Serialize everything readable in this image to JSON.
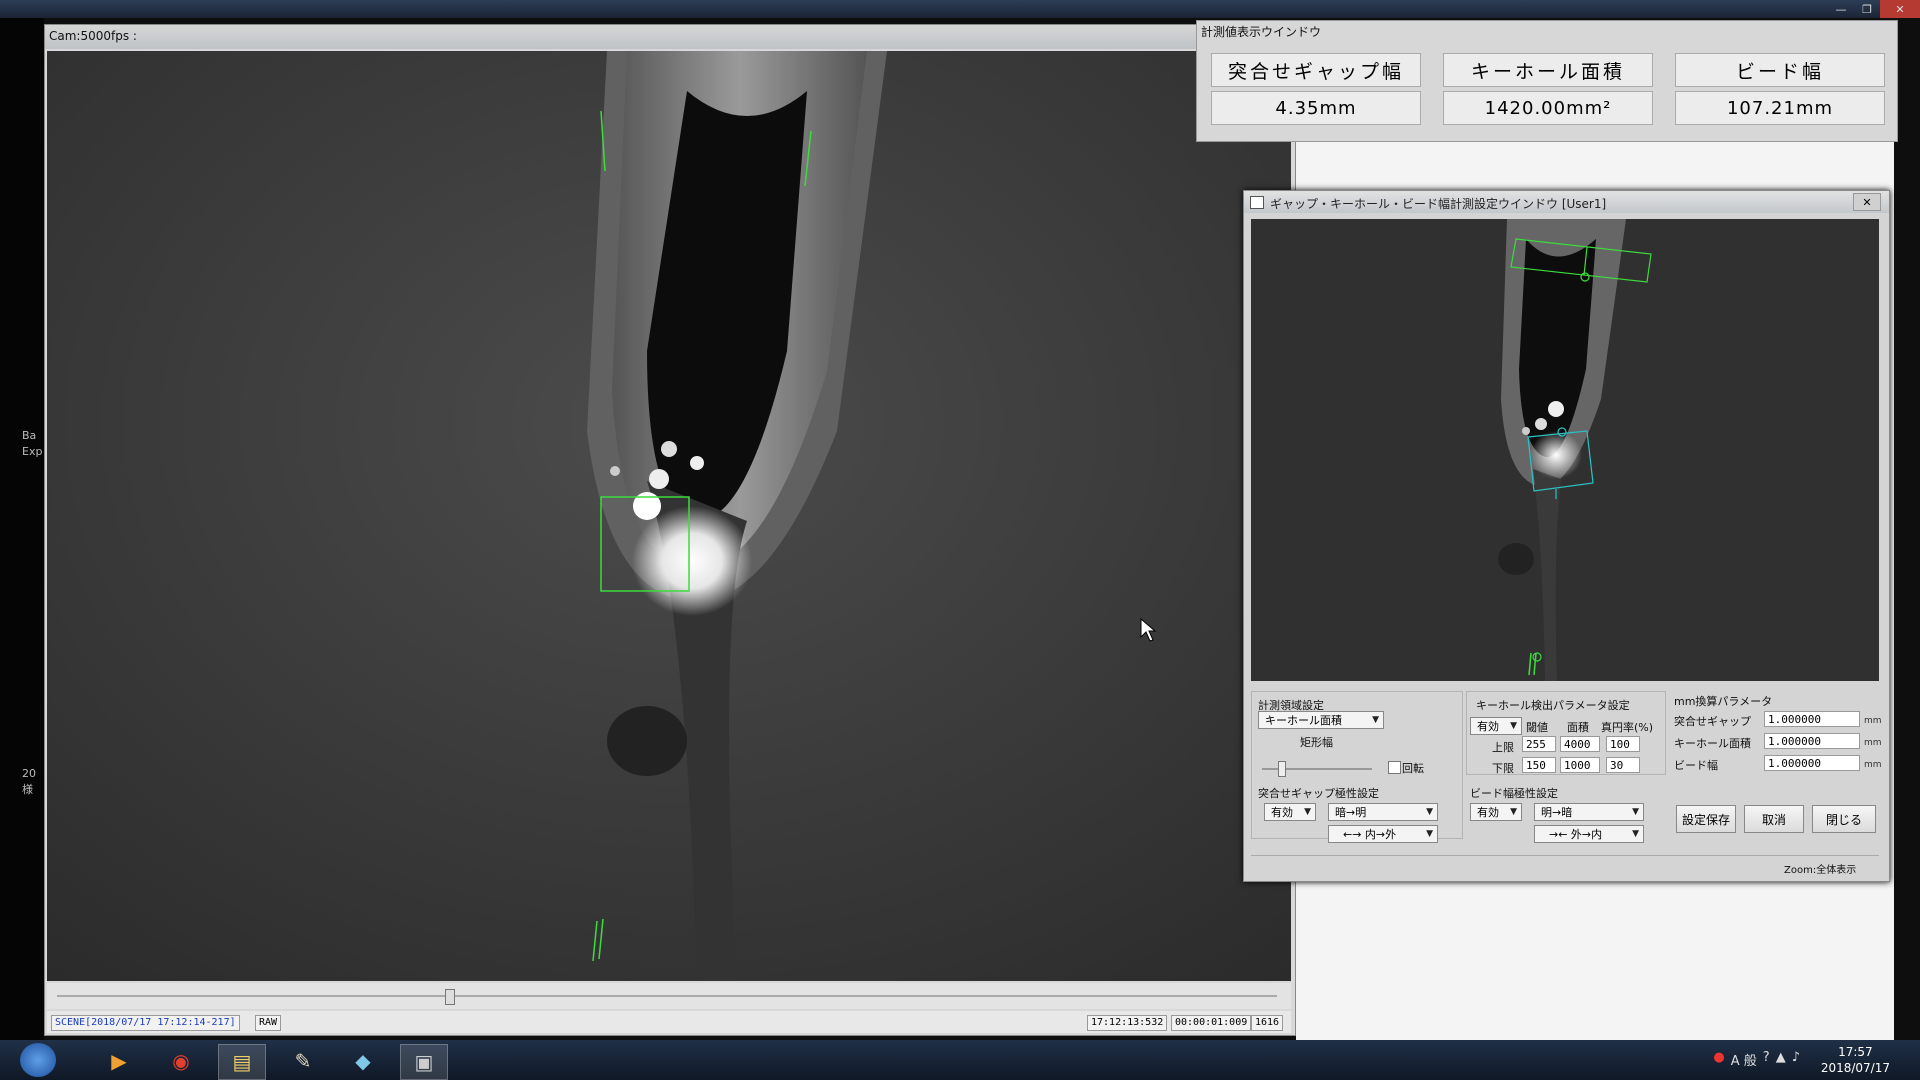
{
  "left_edge_text": [
    "Ba",
    "Exp",
    "20",
    "様"
  ],
  "camera_window": {
    "title": "Cam:5000fps :",
    "status": {
      "scene": "SCENE[2018/07/17 17:12:14-217]",
      "format": "RAW",
      "time": "17:12:13:532",
      "elapsed": "00:00:01:009",
      "frame": "1616"
    }
  },
  "measure_window": {
    "title": "計測値表示ウインドウ",
    "items": [
      {
        "label": "突合せギャップ幅",
        "value": "4.35mm"
      },
      {
        "label": "キーホール面積",
        "value": "1420.00mm²"
      },
      {
        "label": "ビード幅",
        "value": "107.21mm"
      }
    ]
  },
  "settings_window": {
    "title": "ギャップ・キーホール・ビード幅計測設定ウインドウ [User1]",
    "close_label": "✕",
    "region": {
      "title": "計測領域設定",
      "selected": "キーホール面積",
      "rect_width_label": "矩形幅",
      "rotate_label": "回転"
    },
    "gap": {
      "title": "突合せギャップ極性設定",
      "enable": "有効",
      "polarity": "暗→明",
      "direction": "←→ 内→外"
    },
    "keyhole": {
      "title": "キーホール検出パラメータ設定",
      "enable": "有効",
      "col_threshold": "閾値",
      "col_area": "面積",
      "col_ellipse": "真円率(%)",
      "upper_label": "上限",
      "lower_label": "下限",
      "upper": [
        "255",
        "4000",
        "100"
      ],
      "lower": [
        "150",
        "1000",
        "30"
      ]
    },
    "bead": {
      "title": "ビード幅極性設定",
      "enable": "有効",
      "polarity": "明→暗",
      "direction": "→← 外→内"
    },
    "conversion": {
      "title": "mm換算パラメータ",
      "unit": "mm",
      "rows": [
        {
          "label": "突合せギャップ",
          "value": "1.000000"
        },
        {
          "label": "キーホール面積",
          "value": "1.000000"
        },
        {
          "label": "ビード幅",
          "value": "1.000000"
        }
      ]
    },
    "buttons": {
      "save": "設定保存",
      "cancel": "取消",
      "close": "閉じる"
    },
    "zoom": "Zoom:全体表示"
  },
  "taskbar": {
    "tray_ime": "A 般",
    "clock_time": "17:57",
    "clock_date": "2018/07/17"
  }
}
